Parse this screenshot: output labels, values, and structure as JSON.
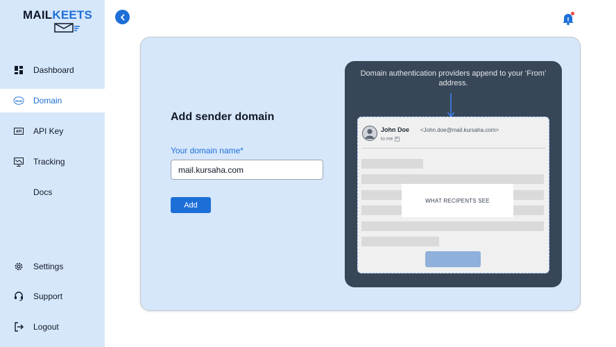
{
  "brand": {
    "part1": "MAIL",
    "part2": "KEETS"
  },
  "sidebar": {
    "items": [
      {
        "label": "Dashboard",
        "icon": "dashboard-icon"
      },
      {
        "label": "Domain",
        "icon": "www-icon",
        "active": true
      },
      {
        "label": "API Key",
        "icon": "api-icon"
      },
      {
        "label": "Tracking",
        "icon": "tracking-icon"
      },
      {
        "label": "Docs",
        "icon": ""
      },
      {
        "label": "Settings",
        "icon": "gear-icon"
      },
      {
        "label": "Support",
        "icon": "headset-icon"
      },
      {
        "label": "Logout",
        "icon": "logout-icon"
      }
    ]
  },
  "form": {
    "title": "Add sender domain",
    "field_label": "Your domain name*",
    "domain_value": "mail.kursaha.com",
    "add_label": "Add"
  },
  "preview": {
    "caption": "Domain authentication providers append to your ‘From’ address.",
    "sender_name": "John Doe",
    "sender_email": "<John.doe@mail.kursaha.com>",
    "to_me": "to me",
    "recipients_label": "WHAT RECIPENTS SEE"
  },
  "colors": {
    "accent": "#1d6fd8",
    "sidebar_bg": "#d6e7fb",
    "preview_bg": "#374757",
    "notification_dot": "#ef4444"
  }
}
